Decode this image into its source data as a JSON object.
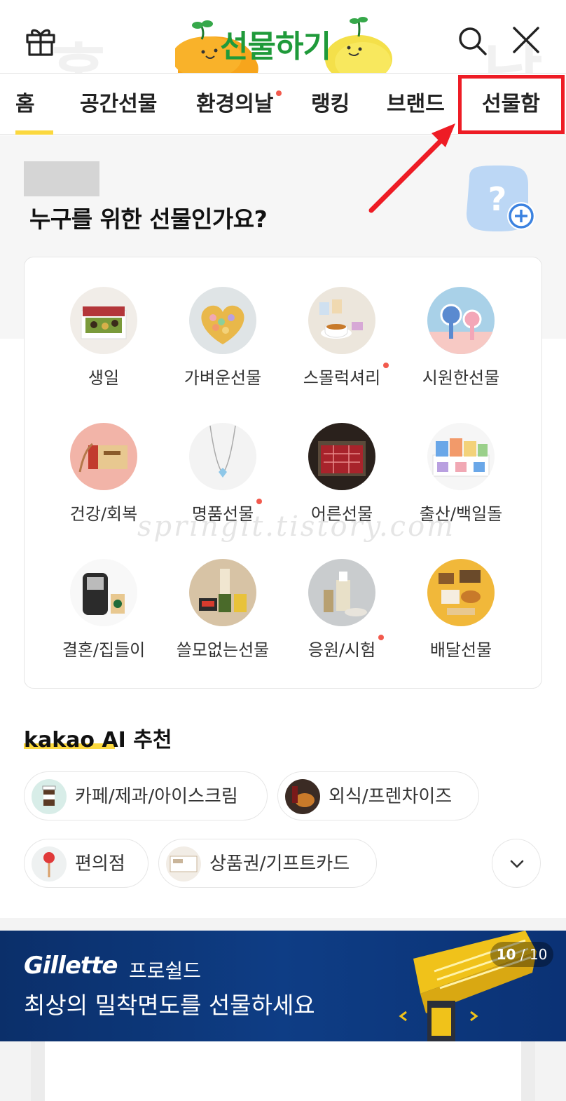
{
  "header": {
    "logo_text": "선물하기",
    "ghost_left": "홈",
    "ghost_right": "남"
  },
  "tabs": [
    {
      "label": "홈",
      "active": true,
      "new_dot": false
    },
    {
      "label": "공간선물",
      "active": false,
      "new_dot": false
    },
    {
      "label": "환경의날",
      "active": false,
      "new_dot": true
    },
    {
      "label": "랭킹",
      "active": false,
      "new_dot": false
    },
    {
      "label": "브랜드",
      "active": false,
      "new_dot": false
    },
    {
      "label": "선물함",
      "active": false,
      "new_dot": false
    }
  ],
  "friend_select": {
    "question": "누구를 위한 선물인가요?"
  },
  "categories": [
    {
      "label": "생일",
      "icon": "birthday-gift-photo",
      "new_dot": false
    },
    {
      "label": "가벼운선물",
      "icon": "macaron-box-photo",
      "new_dot": false
    },
    {
      "label": "스몰럭셔리",
      "icon": "tea-set-photo",
      "new_dot": true
    },
    {
      "label": "시원한선물",
      "icon": "handy-fan-photo",
      "new_dot": false
    },
    {
      "label": "건강/회복",
      "icon": "red-ginseng-photo",
      "new_dot": false
    },
    {
      "label": "명품선물",
      "icon": "necklace-photo",
      "new_dot": true
    },
    {
      "label": "어른선물",
      "icon": "beef-set-photo",
      "new_dot": false
    },
    {
      "label": "출산/백일돌",
      "icon": "baby-goods-photo",
      "new_dot": false
    },
    {
      "label": "결혼/집들이",
      "icon": "coffee-machine-photo",
      "new_dot": false
    },
    {
      "label": "쓸모없는선물",
      "icon": "funny-gift-photo",
      "new_dot": false
    },
    {
      "label": "응원/시험",
      "icon": "serum-bottle-photo",
      "new_dot": true
    },
    {
      "label": "배달선물",
      "icon": "delivery-food-photo",
      "new_dot": false
    }
  ],
  "ai_section": {
    "brand": "kakao AI",
    "suffix": "추천",
    "chips": [
      {
        "label": "카페/제과/아이스크림",
        "icon": "coffee-cup-icon"
      },
      {
        "label": "외식/프렌차이즈",
        "icon": "chicken-icon"
      },
      {
        "label": "편의점",
        "icon": "lollipop-icon"
      },
      {
        "label": "상품권/기프트카드",
        "icon": "gift-card-icon"
      }
    ]
  },
  "banner": {
    "brand": "Gillette",
    "sub": "프로쉴드",
    "title": "최상의 밀착면도를 선물하세요",
    "current": "10",
    "total": "/ 10"
  },
  "watermark": "springit.tistory.com",
  "colors": {
    "accent_yellow": "#fbd83f",
    "logo_green": "#1f9a3a",
    "highlight_red": "#ee1c25",
    "new_dot": "#f25a4d",
    "banner_navy": "#0e3d85"
  }
}
